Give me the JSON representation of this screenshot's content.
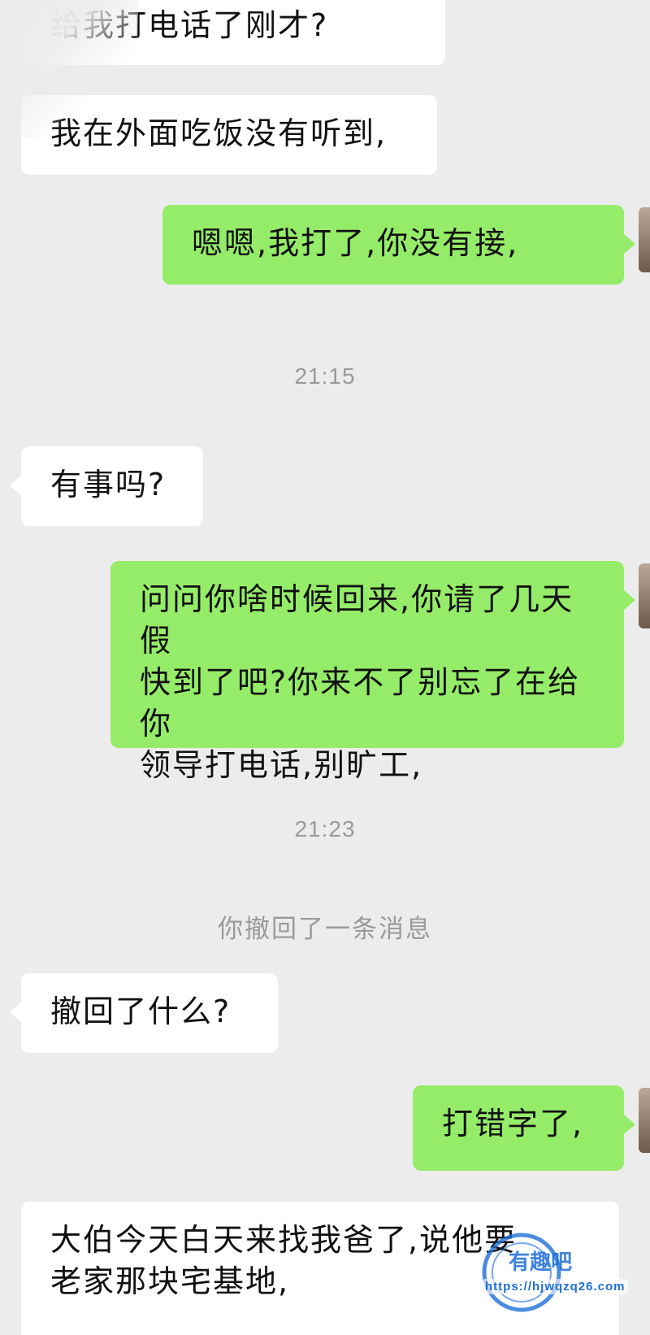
{
  "messages": {
    "m1": "给我打电话了刚才?",
    "m2": "我在外面吃饭没有听到,",
    "m3": "嗯嗯,我打了,你没有接,",
    "t1": "21:15",
    "m4": "有事吗?",
    "m5": "问问你啥时候回来,你请了几天假\n快到了吧?你来不了别忘了在给你\n领导打电话,别旷工,",
    "t2": "21:23",
    "sys1": "你撤回了一条消息",
    "m6": "撤回了什么?",
    "m7": "打错字了,",
    "m8": "大伯今天白天来找我爸了,说他要\n老家那块宅基地,"
  },
  "watermark": {
    "logo_text": "有趣吧",
    "url_text": "https://hjwqzq26.com"
  },
  "colors": {
    "background": "#ececec",
    "incoming_bubble": "#ffffff",
    "outgoing_bubble": "#95ec69",
    "meta_text": "#9a9a9a",
    "watermark_blue": "#1f6fd8"
  }
}
